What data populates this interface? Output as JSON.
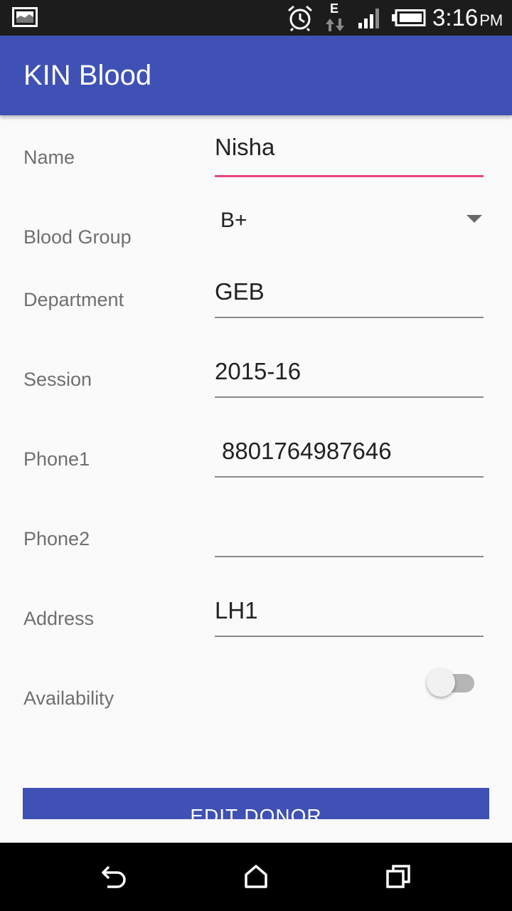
{
  "status_bar": {
    "network_type": "E",
    "time": "3:16",
    "ampm": "PM"
  },
  "app_bar": {
    "title": "KIN Blood"
  },
  "form": {
    "name": {
      "label": "Name",
      "value": "Nisha"
    },
    "blood_group": {
      "label": "Blood Group",
      "value": "B+"
    },
    "department": {
      "label": "Department",
      "value": "GEB"
    },
    "session": {
      "label": "Session",
      "value": "2015-16"
    },
    "phone1": {
      "label": "Phone1",
      "value": "8801764987646"
    },
    "phone2": {
      "label": "Phone2",
      "value": ""
    },
    "address": {
      "label": "Address",
      "value": "LH1"
    },
    "availability": {
      "label": "Availability",
      "checked": false
    }
  },
  "edit_button": {
    "label": "EDIT DONOR"
  },
  "colors": {
    "primary": "#3f51b5",
    "accent": "#e8457b",
    "status_bar": "#1c1c1c"
  },
  "icons": {
    "status": [
      "gallery-icon",
      "alarm-icon",
      "data-transfer-icon",
      "signal-icon",
      "battery-icon"
    ],
    "nav": [
      "back-icon",
      "home-icon",
      "recents-icon"
    ]
  }
}
